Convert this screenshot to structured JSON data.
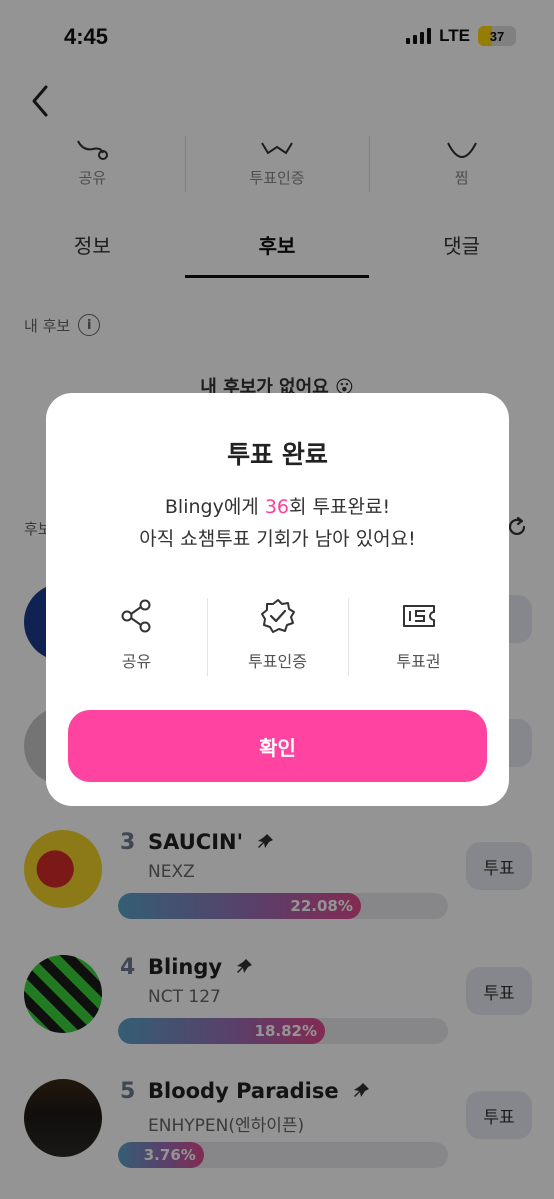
{
  "status_bar": {
    "time": "4:45",
    "network": "LTE",
    "battery": "37",
    "battery_level": 0.37
  },
  "header": {
    "actions": [
      {
        "label": "공유",
        "icon": "share-icon"
      },
      {
        "label": "투표인증",
        "icon": "verify-badge-icon"
      },
      {
        "label": "찜",
        "icon": "heart-icon"
      }
    ]
  },
  "tabs": [
    {
      "label": "정보",
      "active": false
    },
    {
      "label": "후보",
      "active": true
    },
    {
      "label": "댓글",
      "active": false
    }
  ],
  "my_candidate": {
    "label": "내 후보",
    "empty_text": "내 후보가 없어요 😮"
  },
  "candidates_header": "후보",
  "candidates": [
    {
      "rank": "3",
      "title": "SAUCIN'",
      "artist": "NEXZ",
      "percent": "22.08%",
      "share": 22.08,
      "vote_label": "투표"
    },
    {
      "rank": "4",
      "title": "Blingy",
      "artist": "NCT 127",
      "percent": "18.82%",
      "share": 18.82,
      "vote_label": "투표"
    },
    {
      "rank": "5",
      "title": "Bloody Paradise",
      "artist": "ENHYPEN(엔하이픈)",
      "percent": "3.76%",
      "share": 3.76,
      "vote_label": "투표"
    }
  ],
  "partial_vote_labels": [
    "표",
    "표"
  ],
  "modal": {
    "title": "투표 완료",
    "message_prefix": "Blingy에게 ",
    "message_count": "36",
    "message_suffix": "회 투표완료!",
    "message_line2": "아직 쇼챔투표 기회가 남아 있어요!",
    "actions": [
      {
        "label": "공유",
        "icon": "share-icon"
      },
      {
        "label": "투표인증",
        "icon": "verify-badge-icon"
      },
      {
        "label": "투표권",
        "icon": "ticket-icon"
      }
    ],
    "confirm_label": "확인",
    "accent_color": "#ff43a1"
  }
}
